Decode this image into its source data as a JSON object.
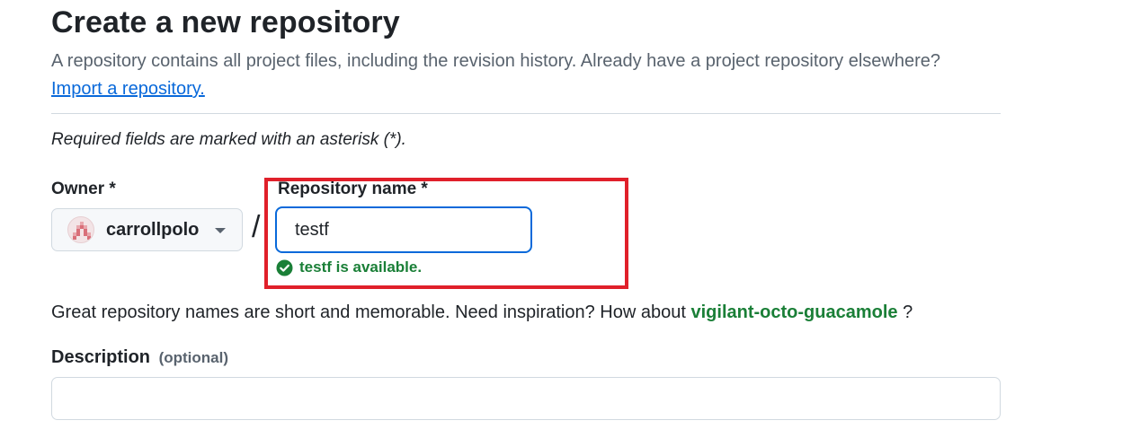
{
  "header": {
    "title": "Create a new repository",
    "subtitle": "A repository contains all project files, including the revision history. Already have a project repository elsewhere?",
    "import_link": "Import a repository."
  },
  "form": {
    "required_note": "Required fields are marked with an asterisk (*).",
    "owner": {
      "label": "Owner *",
      "value": "carrollpolo",
      "icon": "caret-down-icon"
    },
    "separator": "/",
    "repo_name": {
      "label": "Repository name *",
      "value": "testf",
      "availability": "testf is available.",
      "availability_icon": "check-circle-icon"
    },
    "inspiration": {
      "prefix": "Great repository names are short and memorable. Need inspiration? How about",
      "suggestion": "vigilant-octo-guacamole",
      "suffix": "?"
    },
    "description": {
      "label": "Description",
      "optional": "(optional)",
      "value": ""
    }
  },
  "colors": {
    "link": "#0969da",
    "success": "#1a7f37",
    "highlight": "#e0202a",
    "focus_border": "#0969da"
  }
}
